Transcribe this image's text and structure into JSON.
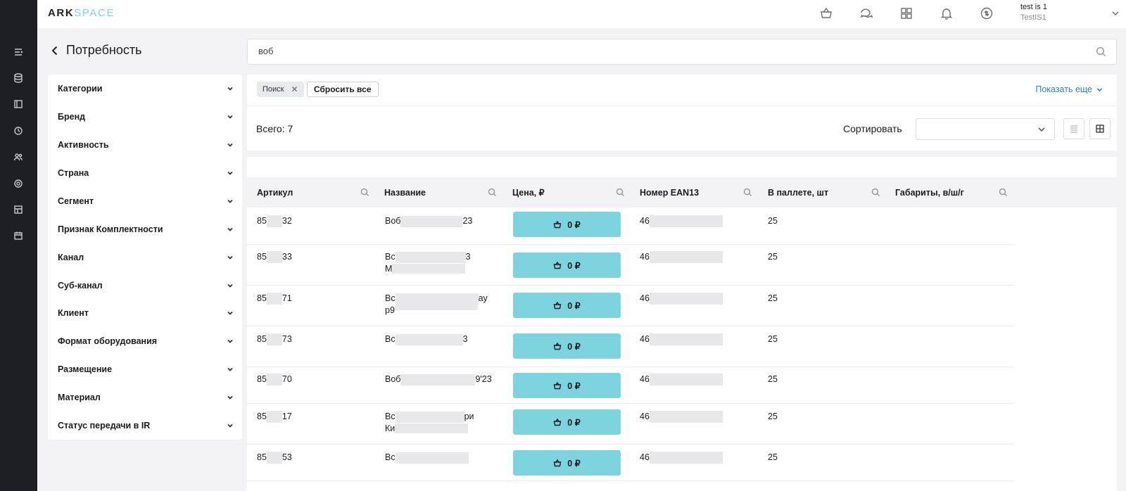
{
  "app": {
    "logo_part1": "ARK",
    "logo_part2": "SPACE"
  },
  "user": {
    "name": "test is 1",
    "role": "TestIS1"
  },
  "rail_icons": [
    "list-icon",
    "database-icon",
    "book-icon",
    "clock-icon",
    "users-icon",
    "settings-icon",
    "grid-table-icon",
    "calendar-icon"
  ],
  "top_icons": [
    "basket-icon",
    "chat-icon",
    "apps-grid-icon",
    "bell-icon",
    "sync-icon"
  ],
  "page": {
    "title": "Потребность"
  },
  "search": {
    "value": "воб",
    "placeholder": ""
  },
  "filters": [
    "Категории",
    "Бренд",
    "Активность",
    "Страна",
    "Сегмент",
    "Признак Комплектности",
    "Канал",
    "Суб-канал",
    "Клиент",
    "Формат оборудования",
    "Размещение",
    "Материал",
    "Статус передачи в IR"
  ],
  "chips": {
    "active": "Поиск",
    "reset_label": "Сбросить все",
    "show_more": "Показать еще"
  },
  "summary": {
    "total": "Всего: 7",
    "sort_label": "Сортировать",
    "sort_value": ""
  },
  "table": {
    "columns": [
      "Артикул",
      "Название",
      "Цена, ₽",
      "Номер EAN13",
      "В паллете, шт",
      "Габариты, в/ш/г"
    ],
    "rows": [
      {
        "sku_a": "85",
        "sku_b": "32",
        "name_a": "Воб",
        "name_b": "23",
        "name2_a": "",
        "name2_b": "",
        "price": "0 ₽",
        "ean": "46",
        "pallet": "25",
        "dims": ""
      },
      {
        "sku_a": "85",
        "sku_b": "33",
        "name_a": "Вс",
        "name_b": "3",
        "name2_a": "М",
        "name2_b": "",
        "price": "0 ₽",
        "ean": "46",
        "pallet": "25",
        "dims": ""
      },
      {
        "sku_a": "85",
        "sku_b": "71",
        "name_a": "Вс",
        "name_b": "ay",
        "name2_a": "р9",
        "name2_b": "",
        "price": "0 ₽",
        "ean": "46",
        "pallet": "25",
        "dims": ""
      },
      {
        "sku_a": "85",
        "sku_b": "73",
        "name_a": "Вс",
        "name_b": "3",
        "name2_a": "",
        "name2_b": "",
        "price": "0 ₽",
        "ean": "46",
        "pallet": "25",
        "dims": ""
      },
      {
        "sku_a": "85",
        "sku_b": "70",
        "name_a": "Воб",
        "name_b": "9'23",
        "name2_a": "",
        "name2_b": "",
        "price": "0 ₽",
        "ean": "46",
        "pallet": "25",
        "dims": ""
      },
      {
        "sku_a": "85",
        "sku_b": "17",
        "name_a": "Вс",
        "name_b": "ри",
        "name2_a": "Ки",
        "name2_b": "",
        "price": "0 ₽",
        "ean": "46",
        "pallet": "25",
        "dims": ""
      },
      {
        "sku_a": "85",
        "sku_b": "53",
        "name_a": "Вс",
        "name_b": "",
        "name2_a": "",
        "name2_b": "",
        "price": "0 ₽",
        "ean": "46",
        "pallet": "25",
        "dims": ""
      }
    ]
  }
}
